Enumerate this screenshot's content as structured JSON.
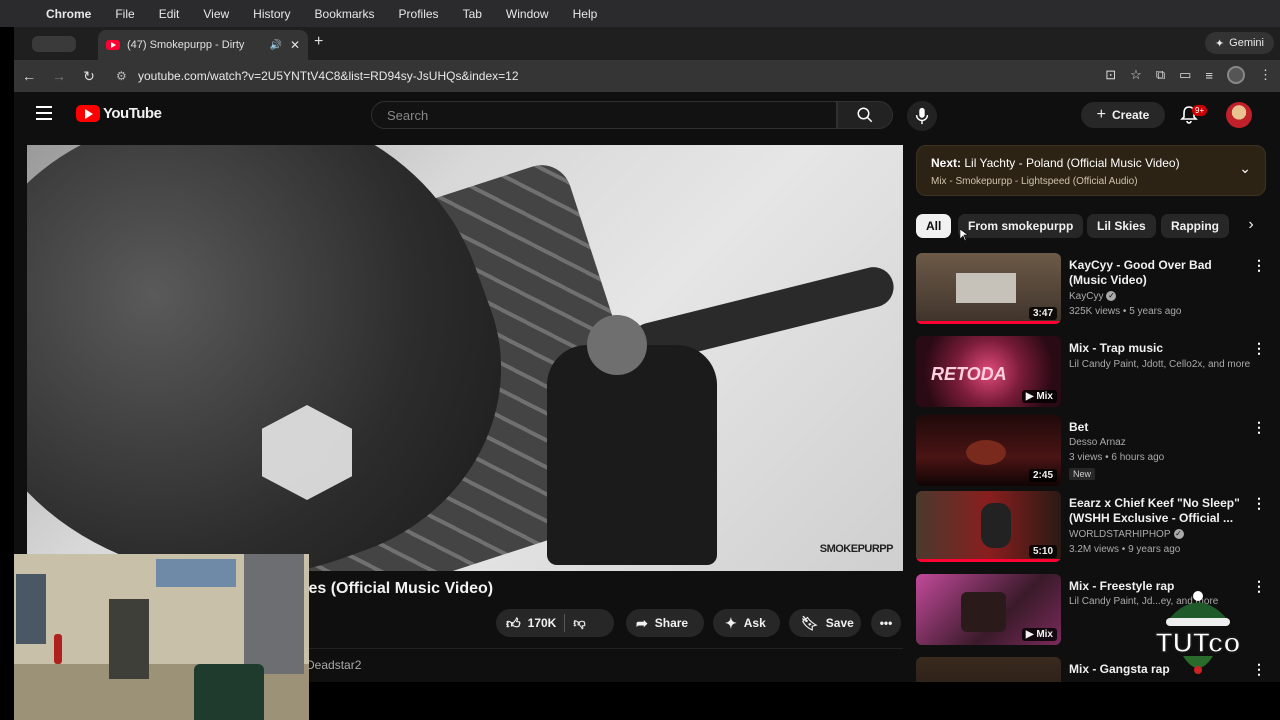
{
  "menubar": {
    "items": [
      "Chrome",
      "File",
      "Edit",
      "View",
      "History",
      "Bookmarks",
      "Profiles",
      "Tab",
      "Window",
      "Help"
    ]
  },
  "browser": {
    "tab_title": "(47) Smokepurpp - Dirty",
    "url": "youtube.com/watch?v=2U5YNTtV4C8&list=RD94sy-JsUHQs&index=12",
    "gemini_label": "Gemini"
  },
  "youtube": {
    "logo_text": "YouTube",
    "search_placeholder": "Search",
    "create_label": "Create",
    "notif_count": "9+",
    "video_title": "ies (Official Music Video)",
    "watermark": "SMOKEPURPP",
    "actions": {
      "likes": "170K",
      "share": "Share",
      "ask": "Ask",
      "save": "Save"
    },
    "channel_partial": "Deadstar2",
    "up_next": {
      "prefix": "Next:",
      "title": "Lil Yachty - Poland (Official Music Video)",
      "subtitle": "Mix - Smokepurpp - Lightspeed (Official Audio)"
    },
    "chips": [
      "All",
      "From smokepurpp",
      "Lil Skies",
      "Rapping"
    ],
    "recommendations": [
      {
        "title": "KayCyy - Good Over Bad (Music Video)",
        "channel": "KayCyy",
        "verified": true,
        "stats": "325K views • 5 years ago",
        "badge": "3:47",
        "progress": 1.0
      },
      {
        "title": "Mix - Trap music",
        "channel": "Lil Candy Paint, Jdott, Cello2x, and more",
        "verified": false,
        "stats": "",
        "badge": "Mix",
        "progress": 0
      },
      {
        "title": "Bet",
        "channel": "Desso Arnaz",
        "verified": false,
        "stats": "3 views • 6 hours ago",
        "badge": "2:45",
        "new": "New",
        "progress": 0
      },
      {
        "title": "Eearz x Chief Keef \"No Sleep\" (WSHH Exclusive - Official ...",
        "channel": "WORLDSTARHIPHOP",
        "verified": true,
        "stats": "3.2M views • 9 years ago",
        "badge": "5:10",
        "progress": 1.0
      },
      {
        "title": "Mix - Freestyle rap",
        "channel": "Lil Candy Paint, Jd...ey, and more",
        "verified": false,
        "stats": "",
        "badge": "Mix",
        "progress": 0
      },
      {
        "title": "Mix - Gangsta rap",
        "channel": "",
        "verified": false,
        "stats": "",
        "badge": "",
        "progress": 0
      }
    ]
  },
  "overlay": {
    "tutco_text": "TUTco"
  },
  "colors": {
    "youtube_red": "#ff0000",
    "progress_red": "#ff0033",
    "background": "#0f0f0f"
  }
}
